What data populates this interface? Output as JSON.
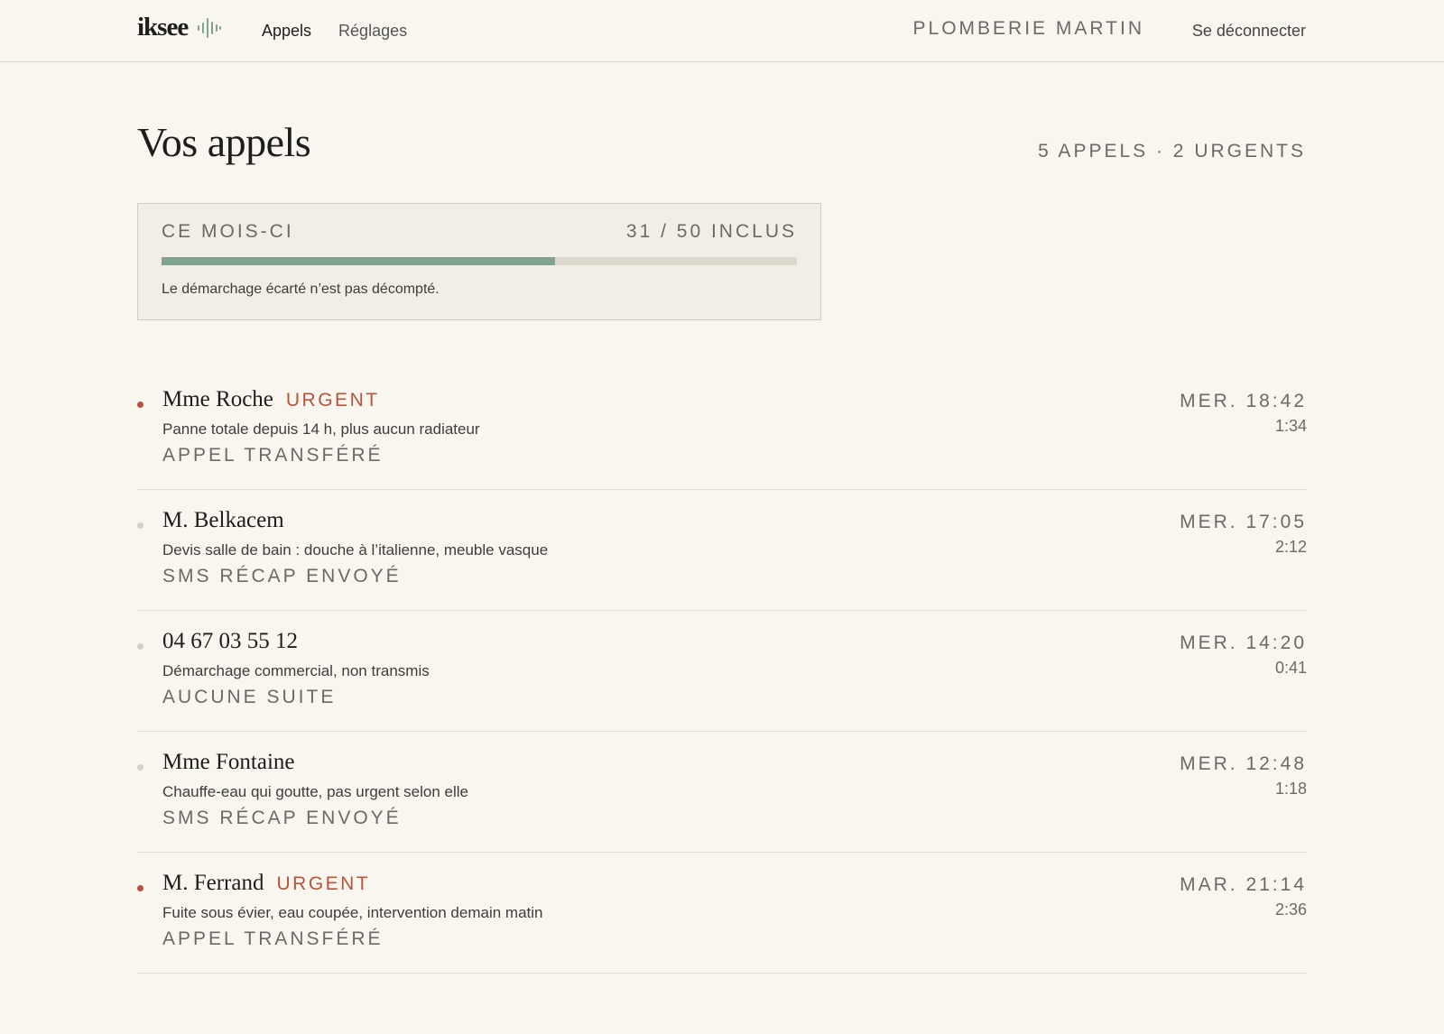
{
  "app": {
    "logo_text": "iksee"
  },
  "nav": {
    "items": [
      {
        "label": "Appels",
        "active": true
      },
      {
        "label": "Réglages",
        "active": false
      }
    ]
  },
  "header": {
    "company": "PLOMBERIE MARTIN",
    "logout_label": "Se déconnecter"
  },
  "page": {
    "title": "Vos appels",
    "summary": "5 APPELS · 2 URGENTS"
  },
  "quota": {
    "label": "CE MOIS-CI",
    "count_label": "31 / 50 INCLUS",
    "used": 31,
    "included": 50,
    "note": "Le démarchage écarté n’est pas décompté."
  },
  "calls": [
    {
      "name": "Mme Roche",
      "urgent": true,
      "urgent_label": "URGENT",
      "description": "Panne totale depuis 14 h, plus aucun radiateur",
      "status": "APPEL TRANSFÉRÉ",
      "time": "MER. 18:42",
      "duration": "1:34"
    },
    {
      "name": "M. Belkacem",
      "urgent": false,
      "urgent_label": "",
      "description": "Devis salle de bain : douche à l’italienne, meuble vasque",
      "status": "SMS RÉCAP ENVOYÉ",
      "time": "MER. 17:05",
      "duration": "2:12"
    },
    {
      "name": "04 67 03 55 12",
      "urgent": false,
      "urgent_label": "",
      "description": "Démarchage commercial, non transmis",
      "status": "AUCUNE SUITE",
      "time": "MER. 14:20",
      "duration": "0:41"
    },
    {
      "name": "Mme Fontaine",
      "urgent": false,
      "urgent_label": "",
      "description": "Chauffe-eau qui goutte, pas urgent selon elle",
      "status": "SMS RÉCAP ENVOYÉ",
      "time": "MER. 12:48",
      "duration": "1:18"
    },
    {
      "name": "M. Ferrand",
      "urgent": true,
      "urgent_label": "URGENT",
      "description": "Fuite sous évier, eau coupée, intervention demain matin",
      "status": "APPEL TRANSFÉRÉ",
      "time": "MAR. 21:14",
      "duration": "2:36"
    }
  ],
  "colors": {
    "accent": "#7fa38f",
    "urgent": "#b4553d",
    "background": "#f9f6f0",
    "text_muted": "#6c6a66"
  },
  "icons": {
    "logo": "sound-wave-icon"
  }
}
